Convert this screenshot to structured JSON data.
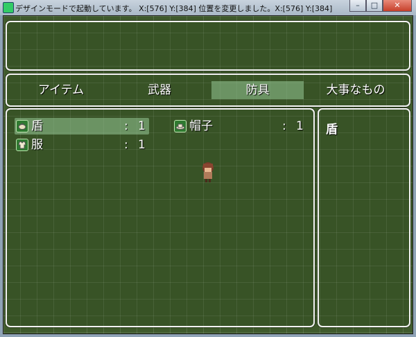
{
  "window": {
    "title": "デザインモードで起動しています。 X:[576] Y:[384] 位置を変更しました。X:[576] Y:[384]",
    "minimize_label": "–",
    "maximize_label": "□",
    "close_label": "✕"
  },
  "categories": [
    "アイテム",
    "武器",
    "防具",
    "大事なもの"
  ],
  "selected_category": "防具",
  "items": [
    {
      "name": "盾",
      "colon": ":",
      "qty": "1",
      "icon": "shield-icon"
    },
    {
      "name": "帽子",
      "colon": ":",
      "qty": "1",
      "icon": "hat-icon"
    },
    {
      "name": "服",
      "colon": ":",
      "qty": "1",
      "icon": "clothes-icon"
    }
  ],
  "selected_item": "盾",
  "description": {
    "title": "盾"
  },
  "colors": {
    "window_border": "#f3f3f3",
    "selection": "#96c896",
    "background": "#3f5a2c"
  }
}
